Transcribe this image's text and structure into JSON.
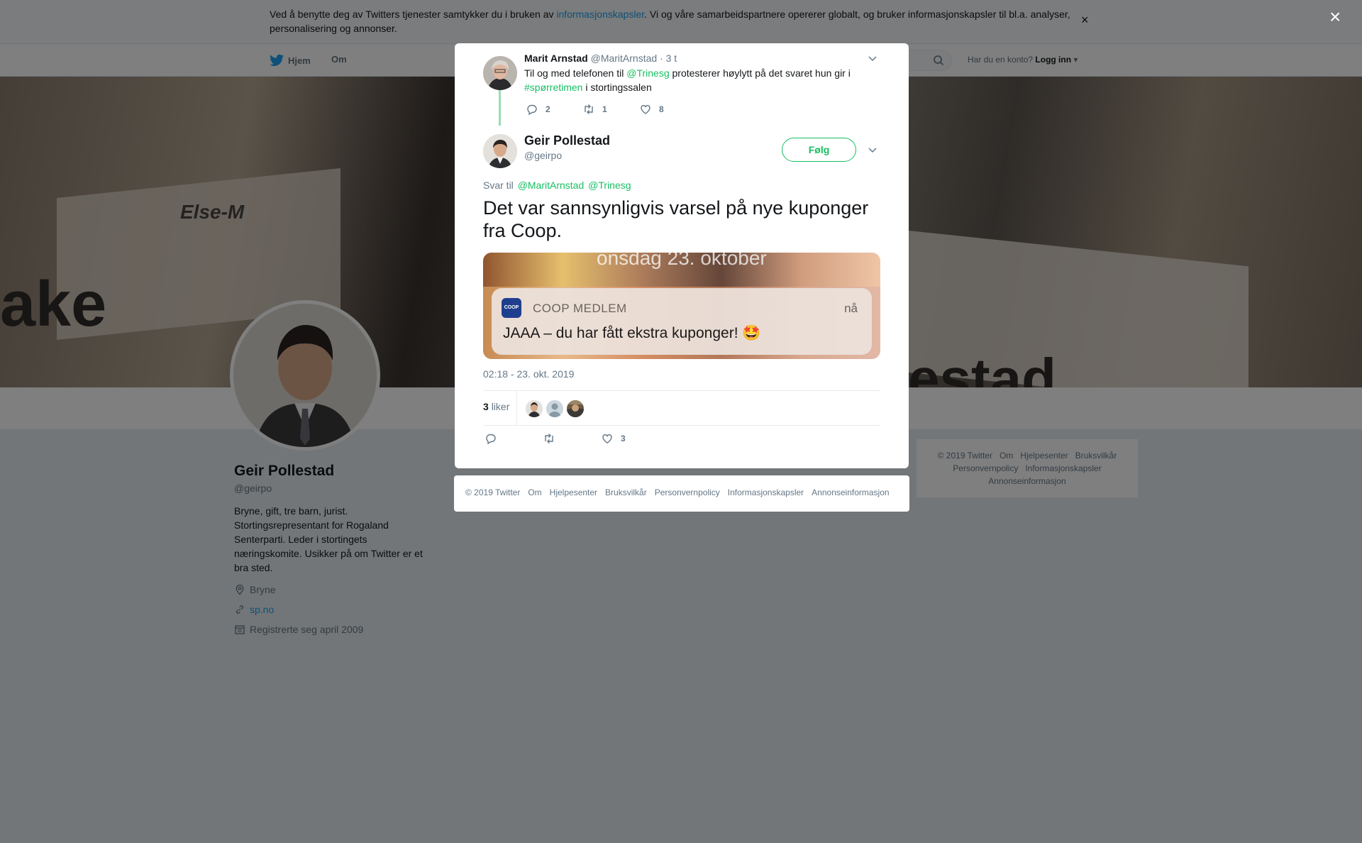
{
  "cookie_banner": {
    "text_before": "Ved å benytte deg av Twitters tjenester samtykker du i bruken av ",
    "link": "informasjonskapsler",
    "text_after": ". Vi og våre samarbeidspartnere opererer globalt, og bruker informasjonskapsler til bl.a. analyser, personalisering og annonser.",
    "close": "×"
  },
  "nav": {
    "home": "Hjem",
    "about": "Om",
    "login_prompt": "Har du en konto?",
    "login": "Logg inn"
  },
  "banner": {
    "text_left": "ake",
    "text_right": "estad",
    "text_mid": "Else-M"
  },
  "profile": {
    "name": "Geir Pollestad",
    "handle": "@geirpo",
    "bio": "Bryne, gift, tre barn, jurist. Stortingsrepresentant for Rogaland Senterparti. Leder i stortingets næringskomite. Usikker på om Twitter er et bra sted.",
    "location": "Bryne",
    "website": "sp.no",
    "joined": "Registrerte seg april 2009"
  },
  "right_footer": {
    "items": [
      "© 2019 Twitter",
      "Om",
      "Hjelpesenter",
      "Bruksvilkår",
      "Personvernpolicy",
      "Informasjonskapsler",
      "Annonseinformasjon"
    ]
  },
  "overlay_close": "×",
  "parent_tweet": {
    "name": "Marit Arnstad",
    "handle": "@MaritArnstad",
    "time": "· 3 t",
    "text_1": "Til og med telefonen til ",
    "mention": "@Trinesg",
    "text_2": " protesterer høylytt på det svaret hun gir i ",
    "hashtag": "#spørretimen",
    "text_3": " i stortingssalen",
    "replies": "2",
    "retweets": "1",
    "likes": "8"
  },
  "main_tweet": {
    "name": "Geir Pollestad",
    "handle": "@geirpo",
    "follow": "Følg",
    "reply_to_label": "Svar til",
    "reply_to_1": "@MaritArnstad",
    "reply_to_2": "@Trinesg",
    "text": "Det var sannsynligvis varsel på nye kuponger fra Coop.",
    "media": {
      "date_partial": "onsdag 23. oktober",
      "logo": "COOP",
      "app": "COOP MEDLEM",
      "time": "nå",
      "message": "JAAA – du har fått ekstra kuponger! 🤩"
    },
    "timestamp": "02:18 - 23. okt. 2019",
    "likes_count": "3",
    "likes_label": "liker",
    "action_likes": "3"
  },
  "modal_footer": {
    "items": [
      "© 2019 Twitter",
      "Om",
      "Hjelpesenter",
      "Bruksvilkår",
      "Personvernpolicy",
      "Informasjonskapsler",
      "Annonseinformasjon"
    ]
  },
  "colors": {
    "accent_green": "#17bf63",
    "twitter_blue": "#1da1f2",
    "overlay": "rgba(0,0,0,0.5)"
  }
}
